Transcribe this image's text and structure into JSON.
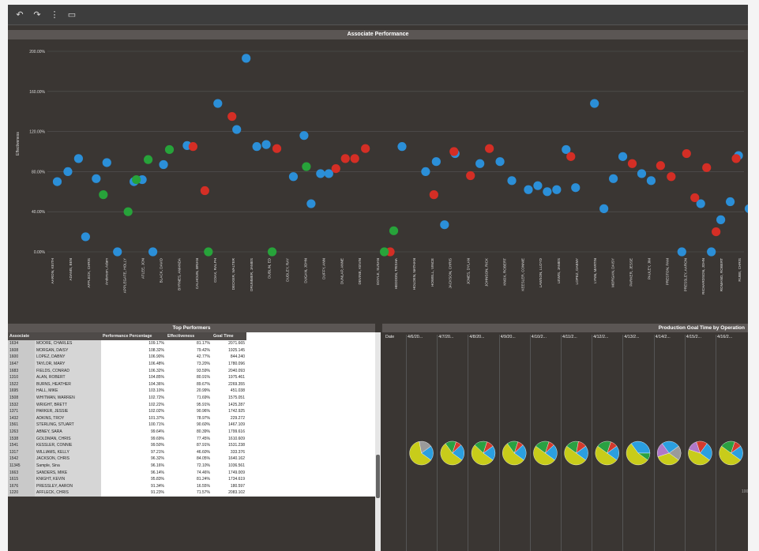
{
  "toolbar": {
    "icons": [
      {
        "name": "undo-icon",
        "glyph": "↶"
      },
      {
        "name": "redo-icon",
        "glyph": "↷"
      },
      {
        "name": "divider-icon",
        "glyph": "⋮"
      },
      {
        "name": "screen-icon",
        "glyph": "▭"
      }
    ]
  },
  "scatter": {
    "title": "Associate Performance",
    "y_axis_label": "Effectiveness",
    "y_ticks": [
      "200.00%",
      "160.00%",
      "120.00%",
      "80.00%",
      "40.00%",
      "0.00%"
    ]
  },
  "colors": {
    "blue": "#2b8fd8",
    "red": "#d42e25",
    "green": "#27a33a",
    "pie_yellow": "#c8cc1a",
    "pie_blue": "#2b9fe0",
    "pie_green": "#2aa142",
    "pie_red": "#d33b2e",
    "pie_purple": "#b078c8",
    "pie_grey": "#9a9a9a"
  },
  "chart_data": {
    "type": "scatter",
    "title": "Associate Performance",
    "ylabel": "Effectiveness",
    "ylim": [
      0,
      200
    ],
    "y_unit": "%",
    "x_labels": [
      "AARON, KEITH",
      "ADAMS, BEN",
      "AFFLECK, CHRIS",
      "Anderson, Adam",
      "APPLEGATE, HOLLY",
      "ATLEE, JON",
      "BLACK, DAVID",
      "BYRNES, AMANDA",
      "CALHOUN, BRIAN",
      "COAX, RALPH",
      "DECKER, WALTER",
      "DRUMMER, JAMES",
      "DUBLIN, ED",
      "DUDLEY, RAY",
      "DUGAN, JOHN",
      "DUFFY, ANN",
      "DUNLAP, ANNE",
      "DEVINE, KEVIN",
      "DOYLE, SUSAN",
      "HEDDON, TRISHA",
      "HOLDEN, NATHAN",
      "HOWELL, VINCE",
      "JACKSON, CHRIS",
      "JONES, DYLAN",
      "JOHNSON, RICK",
      "KNOX, ROBERT",
      "KEESLER, CONNIE",
      "LAWSON, LLOYD",
      "LEWIS, JAMES",
      "LOPEZ, DABNY",
      "LYNN, MARTIN",
      "MORGAN, DAISY",
      "PARKER, JESSE",
      "PAULEY, JIM",
      "PRESTON, PAM",
      "PRESSLEY, AARON",
      "RICHARDSON, JOHN",
      "ROMANO, ROBERT",
      "RUBE, CHRIS"
    ],
    "series": [
      {
        "color": "blue",
        "points": [
          [
            0.3,
            70
          ],
          [
            1.2,
            80
          ],
          [
            2.1,
            93
          ],
          [
            2.7,
            15
          ],
          [
            3.6,
            73
          ],
          [
            4.5,
            89
          ],
          [
            5.4,
            0
          ],
          [
            6.8,
            70
          ],
          [
            7.5,
            72
          ],
          [
            8.4,
            0
          ],
          [
            9.3,
            87
          ],
          [
            11.3,
            106
          ],
          [
            13.9,
            148
          ],
          [
            15.5,
            122
          ],
          [
            16.3,
            193
          ],
          [
            17.2,
            105
          ],
          [
            18.0,
            107
          ],
          [
            20.3,
            75
          ],
          [
            21.2,
            116
          ],
          [
            21.8,
            48
          ],
          [
            22.6,
            78
          ],
          [
            23.3,
            78
          ],
          [
            29.5,
            105
          ],
          [
            31.5,
            80
          ],
          [
            32.4,
            90
          ],
          [
            33.1,
            27
          ],
          [
            34.0,
            98
          ],
          [
            36.1,
            88
          ],
          [
            37.8,
            90
          ],
          [
            38.8,
            71
          ],
          [
            40.2,
            62
          ],
          [
            41.0,
            66
          ],
          [
            41.8,
            60
          ],
          [
            42.6,
            62
          ],
          [
            43.4,
            102
          ],
          [
            44.2,
            64
          ],
          [
            45.8,
            148
          ],
          [
            46.6,
            43
          ],
          [
            47.4,
            73
          ],
          [
            48.2,
            95
          ],
          [
            49.8,
            78
          ],
          [
            50.6,
            71
          ],
          [
            53.2,
            0
          ],
          [
            54.8,
            48
          ],
          [
            55.7,
            0
          ],
          [
            56.5,
            32
          ],
          [
            57.3,
            50
          ],
          [
            58.0,
            96
          ],
          [
            58.9,
            43
          ]
        ]
      },
      {
        "color": "red",
        "points": [
          [
            11.8,
            105
          ],
          [
            12.8,
            61
          ],
          [
            15.1,
            135
          ],
          [
            18.9,
            103
          ],
          [
            23.9,
            83
          ],
          [
            24.7,
            93
          ],
          [
            25.5,
            93
          ],
          [
            26.4,
            103
          ],
          [
            28.5,
            0
          ],
          [
            32.2,
            57
          ],
          [
            33.9,
            100
          ],
          [
            35.3,
            76
          ],
          [
            36.9,
            103
          ],
          [
            43.8,
            95
          ],
          [
            49.0,
            88
          ],
          [
            51.4,
            86
          ],
          [
            52.3,
            75
          ],
          [
            53.6,
            98
          ],
          [
            54.3,
            54
          ],
          [
            56.1,
            20
          ],
          [
            55.3,
            84
          ],
          [
            57.8,
            93
          ]
        ]
      },
      {
        "color": "green",
        "points": [
          [
            4.2,
            57
          ],
          [
            6.3,
            40
          ],
          [
            7.0,
            72
          ],
          [
            8.0,
            92
          ],
          [
            9.8,
            102
          ],
          [
            13.1,
            0
          ],
          [
            18.5,
            0
          ],
          [
            21.4,
            85
          ],
          [
            28.0,
            0
          ],
          [
            28.8,
            21
          ]
        ]
      }
    ]
  },
  "top_performers": {
    "title": "Top Performers",
    "columns": [
      "Associate",
      "",
      "Performance Percentage",
      "Effectiveness",
      "Goal Time"
    ],
    "rows": [
      [
        "1634",
        "MOORE, CHARLES",
        "109.17%",
        "81.17%",
        "2071.665"
      ],
      [
        "1608",
        "MORGAN, DAISY",
        "108.32%",
        "79.42%",
        "1925.145"
      ],
      [
        "1600",
        "LOPEZ, DABNY",
        "106.90%",
        "42.77%",
        "844.240"
      ],
      [
        "1647",
        "TAYLOR, MARY",
        "106.48%",
        "73.20%",
        "1780.096"
      ],
      [
        "1683",
        "FIELDS, CONRAD",
        "106.32%",
        "93.59%",
        "2040.093"
      ],
      [
        "1310",
        "ALAN, ROBERT",
        "104.85%",
        "80.91%",
        "1975.461"
      ],
      [
        "1522",
        "BURNS, HEATHER",
        "104.36%",
        "89.67%",
        "2269.355"
      ],
      [
        "1695",
        "HALL, MIKE",
        "103.10%",
        "20.99%",
        "451.038"
      ],
      [
        "1508",
        "WHITMAN, WARREN",
        "102.72%",
        "71.69%",
        "1575.051"
      ],
      [
        "1532",
        "WRIGHT, BRETT",
        "102.22%",
        "95.91%",
        "1425.287"
      ],
      [
        "1371",
        "PARKER, JESSIE",
        "102.02%",
        "90.96%",
        "1742.925"
      ],
      [
        "1432",
        "ADKINS, TROY",
        "101.37%",
        "78.97%",
        "229.272"
      ],
      [
        "1561",
        "STERLING, STUART",
        "100.71%",
        "90.60%",
        "1467.109"
      ],
      [
        "1263",
        "ABNEY, SARA",
        "99.64%",
        "80.39%",
        "1799.616"
      ],
      [
        "1538",
        "GOLDMAN, CHRIS",
        "99.69%",
        "77.45%",
        "1610.609"
      ],
      [
        "1541",
        "KESSLER, CONNIE",
        "99.50%",
        "87.91%",
        "1531.238"
      ],
      [
        "1317",
        "WILLIAMS, KELLY",
        "97.21%",
        "46.60%",
        "333.376"
      ],
      [
        "1542",
        "JACKSON, CHRIS",
        "96.32%",
        "84.05%",
        "1640.162"
      ],
      [
        "11345",
        "Sample, Sina",
        "96.16%",
        "72.10%",
        "1036.561"
      ],
      [
        "1663",
        "SANDERS, MIKE",
        "96.14%",
        "74.46%",
        "1749.009"
      ],
      [
        "1615",
        "KNIGHT, KEVIN",
        "95.83%",
        "81.24%",
        "1734.619"
      ],
      [
        "1676",
        "PRESSLEY, AARON",
        "91.34%",
        "16.55%",
        "180.597"
      ],
      [
        "1220",
        "AFFLECK, CHRIS",
        "91.23%",
        "71.57%",
        "2083.102"
      ]
    ]
  },
  "production_goal": {
    "title": "Production Goal Time by Operation",
    "date_label": "Date",
    "columns": [
      "4/6/20...",
      "4/7/20...",
      "4/8/20...",
      "4/9/20...",
      "4/10/2...",
      "4/11/2...",
      "4/12/2...",
      "4/13/2...",
      "4/14/2...",
      "4/15/2...",
      "4/16/2..."
    ],
    "pies": [
      [
        {
          "c": "pie_yellow",
          "v": 0.62
        },
        {
          "c": "pie_grey",
          "v": 0.18
        },
        {
          "c": "pie_blue",
          "v": 0.2
        }
      ],
      [
        {
          "c": "pie_yellow",
          "v": 0.55
        },
        {
          "c": "pie_green",
          "v": 0.15
        },
        {
          "c": "pie_red",
          "v": 0.08
        },
        {
          "c": "pie_blue",
          "v": 0.22
        }
      ],
      [
        {
          "c": "pie_yellow",
          "v": 0.52
        },
        {
          "c": "pie_green",
          "v": 0.18
        },
        {
          "c": "pie_red",
          "v": 0.1
        },
        {
          "c": "pie_blue",
          "v": 0.2
        }
      ],
      [
        {
          "c": "pie_yellow",
          "v": 0.55
        },
        {
          "c": "pie_green",
          "v": 0.15
        },
        {
          "c": "pie_red",
          "v": 0.08
        },
        {
          "c": "pie_blue",
          "v": 0.22
        }
      ],
      [
        {
          "c": "pie_yellow",
          "v": 0.5
        },
        {
          "c": "pie_green",
          "v": 0.2
        },
        {
          "c": "pie_red",
          "v": 0.08
        },
        {
          "c": "pie_blue",
          "v": 0.22
        }
      ],
      [
        {
          "c": "pie_yellow",
          "v": 0.5
        },
        {
          "c": "pie_green",
          "v": 0.18
        },
        {
          "c": "pie_red",
          "v": 0.12
        },
        {
          "c": "pie_blue",
          "v": 0.2
        }
      ],
      [
        {
          "c": "pie_yellow",
          "v": 0.5
        },
        {
          "c": "pie_green",
          "v": 0.2
        },
        {
          "c": "pie_red",
          "v": 0.1
        },
        {
          "c": "pie_blue",
          "v": 0.2
        }
      ],
      [
        {
          "c": "pie_yellow",
          "v": 0.55
        },
        {
          "c": "pie_blue",
          "v": 0.35
        },
        {
          "c": "pie_green",
          "v": 0.1
        }
      ],
      [
        {
          "c": "pie_yellow",
          "v": 0.35
        },
        {
          "c": "pie_purple",
          "v": 0.2
        },
        {
          "c": "pie_blue",
          "v": 0.25
        },
        {
          "c": "pie_grey",
          "v": 0.2
        }
      ],
      [
        {
          "c": "pie_yellow",
          "v": 0.45
        },
        {
          "c": "pie_purple",
          "v": 0.15
        },
        {
          "c": "pie_red",
          "v": 0.15
        },
        {
          "c": "pie_blue",
          "v": 0.25
        }
      ],
      [
        {
          "c": "pie_yellow",
          "v": 0.5
        },
        {
          "c": "pie_green",
          "v": 0.2
        },
        {
          "c": "pie_red",
          "v": 0.1
        },
        {
          "c": "pie_blue",
          "v": 0.2
        }
      ]
    ],
    "right_tick": "100"
  }
}
